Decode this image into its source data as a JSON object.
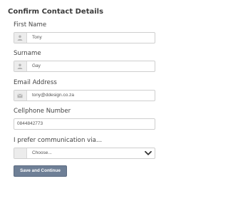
{
  "form": {
    "title": "Confirm Contact Details",
    "first_name": {
      "label": "First Name",
      "value": "Tony",
      "icon": "user-icon"
    },
    "surname": {
      "label": "Surname",
      "value": "Gay",
      "icon": "user-icon"
    },
    "email": {
      "label": "Email Address",
      "value": "tony@ddesign.co.za",
      "icon": "envelope-icon"
    },
    "cellphone": {
      "label": "Cellphone Number",
      "value": "0844842773"
    },
    "communication": {
      "label": "I prefer communication via...",
      "selected": "Choose..."
    },
    "submit_label": "Save and Continue"
  },
  "colors": {
    "button": "#6e7f96",
    "addon_background": "#ececec",
    "field_border": "#cfcfcf"
  }
}
